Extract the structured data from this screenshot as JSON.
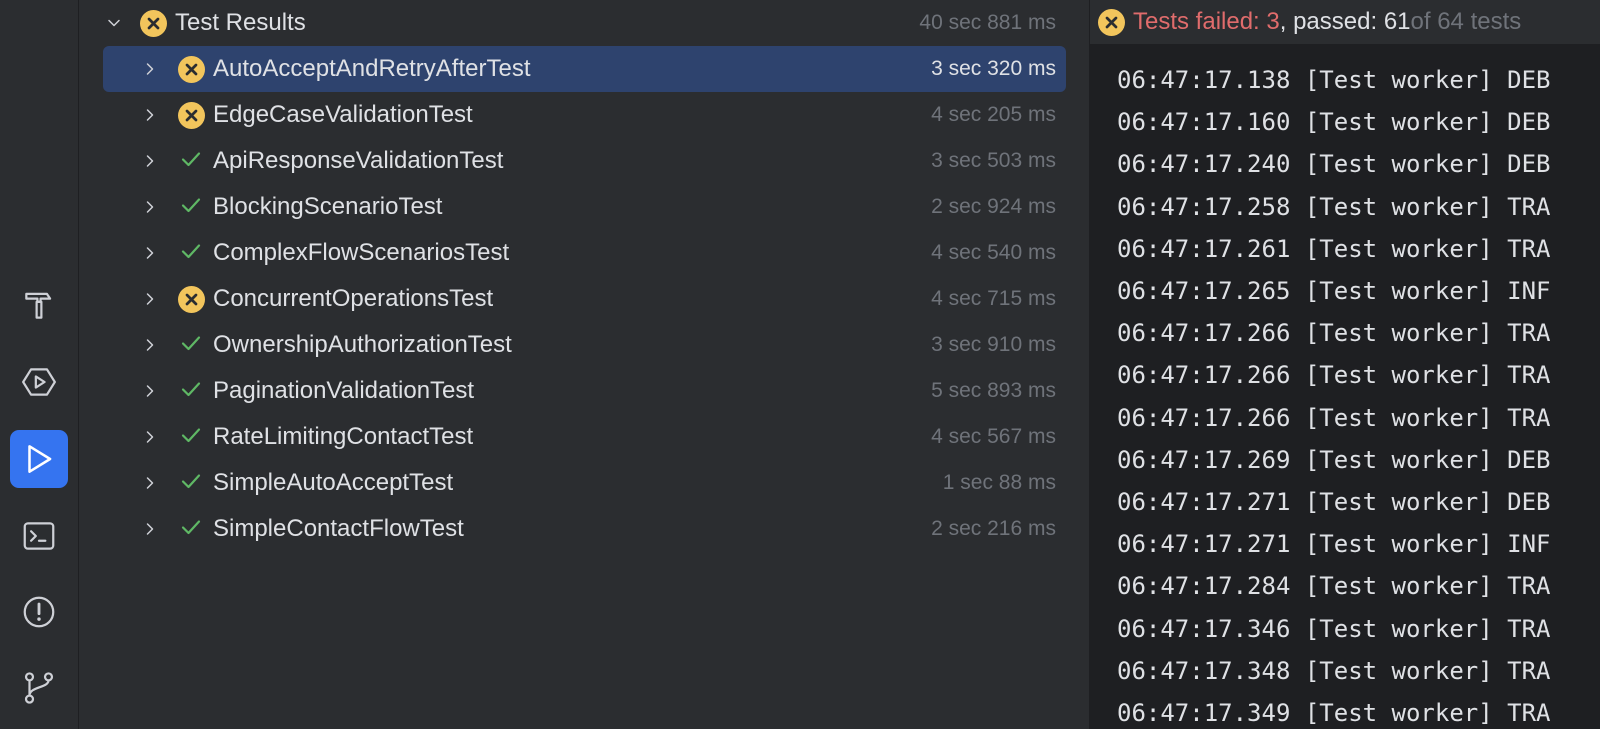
{
  "tool_strip": {
    "items": [
      {
        "icon": "build-hammer-icon",
        "active": false
      },
      {
        "icon": "services-icon",
        "active": false
      },
      {
        "icon": "run-icon",
        "active": true
      },
      {
        "icon": "terminal-icon",
        "active": false
      },
      {
        "icon": "problems-icon",
        "active": false
      },
      {
        "icon": "git-branch-icon",
        "active": false
      }
    ],
    "accent_color": "#3574f0"
  },
  "test_tree": {
    "root": {
      "name": "Test Results",
      "duration": "40 sec 881 ms",
      "status": "failed",
      "expanded": true
    },
    "items": [
      {
        "name": "AutoAcceptAndRetryAfterTest",
        "duration": "3 sec 320 ms",
        "status": "failed",
        "selected": true
      },
      {
        "name": "EdgeCaseValidationTest",
        "duration": "4 sec 205 ms",
        "status": "failed",
        "selected": false
      },
      {
        "name": "ApiResponseValidationTest",
        "duration": "3 sec 503 ms",
        "status": "passed",
        "selected": false
      },
      {
        "name": "BlockingScenarioTest",
        "duration": "2 sec 924 ms",
        "status": "passed",
        "selected": false
      },
      {
        "name": "ComplexFlowScenariosTest",
        "duration": "4 sec 540 ms",
        "status": "passed",
        "selected": false
      },
      {
        "name": "ConcurrentOperationsTest",
        "duration": "4 sec 715 ms",
        "status": "failed",
        "selected": false
      },
      {
        "name": "OwnershipAuthorizationTest",
        "duration": "3 sec 910 ms",
        "status": "passed",
        "selected": false
      },
      {
        "name": "PaginationValidationTest",
        "duration": "5 sec 893 ms",
        "status": "passed",
        "selected": false
      },
      {
        "name": "RateLimitingContactTest",
        "duration": "4 sec 567 ms",
        "status": "passed",
        "selected": false
      },
      {
        "name": "SimpleAutoAcceptTest",
        "duration": "1 sec 88 ms",
        "status": "passed",
        "selected": false
      },
      {
        "name": "SimpleContactFlowTest",
        "duration": "2 sec 216 ms",
        "status": "passed",
        "selected": false
      }
    ]
  },
  "console": {
    "summary": {
      "failed_label": "Tests failed: 3",
      "passed_label": ", passed: 61",
      "total_label": " of 64 tests"
    },
    "lines": [
      "06:47:17.138 [Test worker] DEB",
      "06:47:17.160 [Test worker] DEB",
      "06:47:17.240 [Test worker] DEB",
      "06:47:17.258 [Test worker] TRA",
      "06:47:17.261 [Test worker] TRA",
      "06:47:17.265 [Test worker] INF",
      "06:47:17.266 [Test worker] TRA",
      "06:47:17.266 [Test worker] TRA",
      "06:47:17.266 [Test worker] TRA",
      "06:47:17.269 [Test worker] DEB",
      "06:47:17.271 [Test worker] DEB",
      "06:47:17.271 [Test worker] INF",
      "06:47:17.284 [Test worker] TRA",
      "06:47:17.346 [Test worker] TRA",
      "06:47:17.348 [Test worker] TRA",
      "06:47:17.349 [Test worker] TRA"
    ]
  },
  "colors": {
    "failed": "#f2c55c",
    "passed": "#5fb865",
    "failed_text": "#e06c6c",
    "selection": "#2e436e"
  }
}
